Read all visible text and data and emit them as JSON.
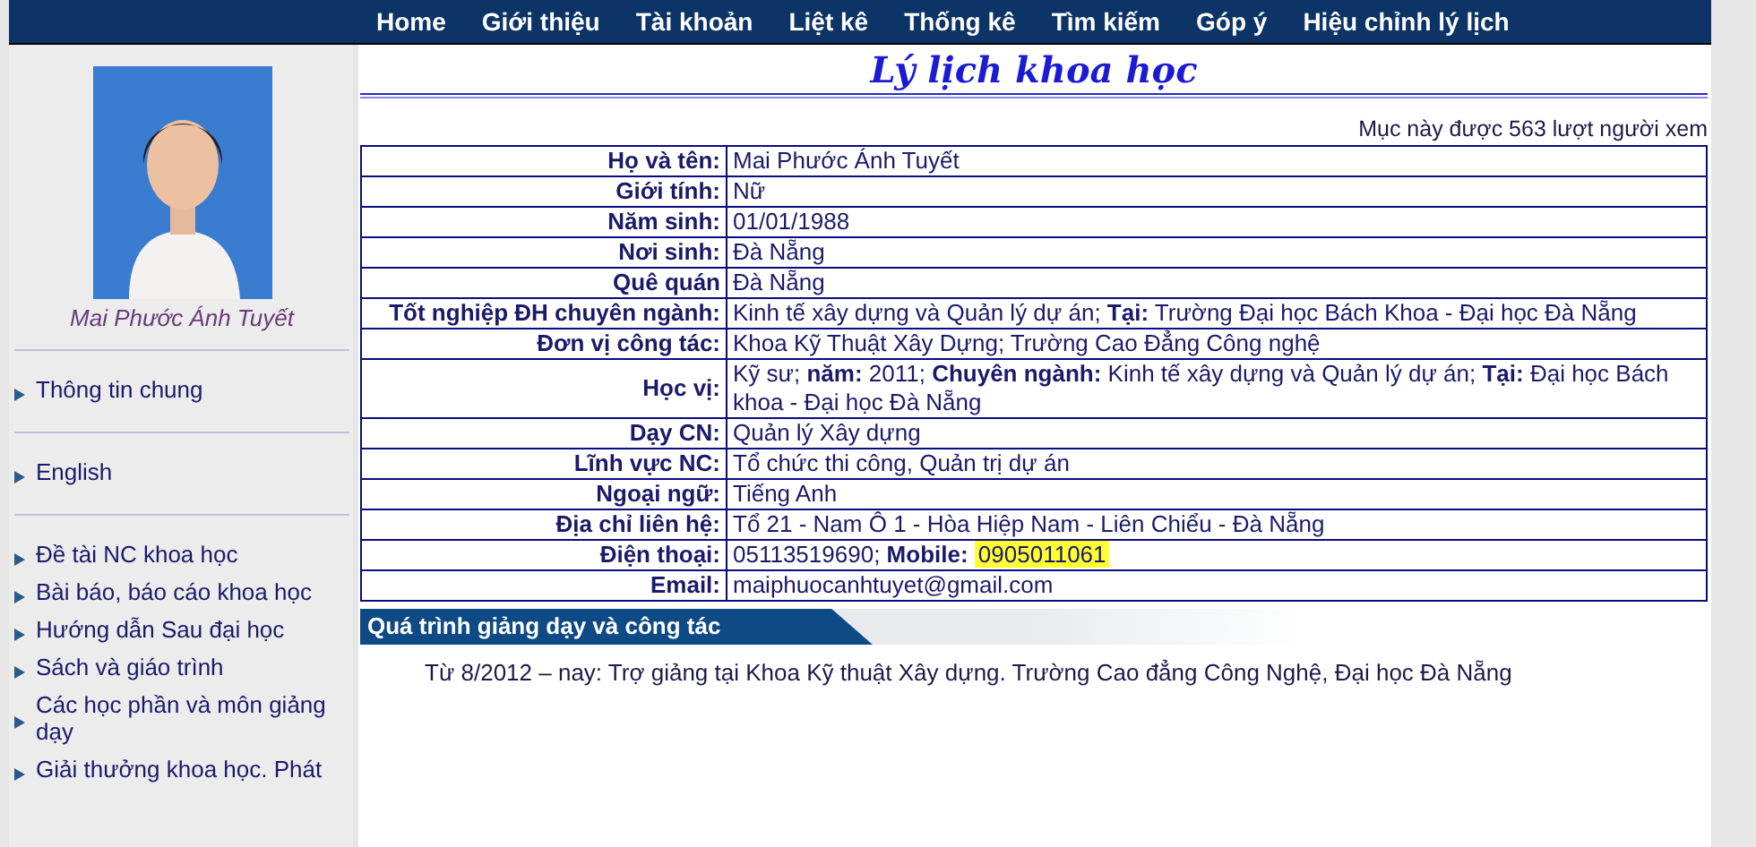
{
  "nav": [
    "Home",
    "Giới thiệu",
    "Tài khoản",
    "Liệt kê",
    "Thống kê",
    "Tìm kiếm",
    "Góp ý",
    "Hiệu chỉnh lý lịch"
  ],
  "sidebar": {
    "name": "Mai Phước Ánh Tuyết",
    "groups": [
      [
        "Thông tin chung"
      ],
      [
        "English"
      ],
      [
        "Đề tài NC khoa học",
        "Bài báo, báo cáo khoa học",
        "Hướng dẫn Sau đại học",
        "Sách và giáo trình",
        "Các học phần và môn giảng dạy",
        "Giải thưởng khoa học. Phát"
      ]
    ]
  },
  "page_title": "Lý lịch khoa học",
  "view_count": "Mục này được 563 lượt người xem",
  "profile": [
    {
      "label": "Họ và tên:",
      "value": "Mai Phước Ánh Tuyết"
    },
    {
      "label": "Giới tính:",
      "value": "Nữ"
    },
    {
      "label": "Năm sinh:",
      "value": "01/01/1988"
    },
    {
      "label": "Nơi sinh:",
      "value": "Đà Nẵng"
    },
    {
      "label": "Quê quán",
      "value": "Đà Nẵng"
    },
    {
      "label": "Tốt nghiệp ĐH chuyên ngành:",
      "value": "Kinh tế xây dựng và Quản lý dự án; **Tại:** Trường Đại học Bách Khoa - Đại học Đà Nẵng"
    },
    {
      "label": "Đơn vị công tác:",
      "value": "Khoa Kỹ Thuật Xây Dựng; Trường Cao Đẳng Công nghệ"
    },
    {
      "label": "Học vị:",
      "value": "Kỹ sư; **năm:** 2011; **Chuyên ngành:** Kinh tế xây dựng và Quản lý dự án; **Tại:** Đại học Bách khoa - Đại học Đà Nẵng"
    },
    {
      "label": "Dạy CN:",
      "value": "Quản lý Xây dựng"
    },
    {
      "label": "Lĩnh vực NC:",
      "value": "Tổ chức thi công, Quản trị dự án"
    },
    {
      "label": "Ngoại ngữ:",
      "value": "Tiếng Anh"
    },
    {
      "label": "Địa chỉ liên hệ:",
      "value": "Tổ 21 - Nam Ô 1 - Hòa Hiệp Nam - Liên Chiểu - Đà Nẵng"
    },
    {
      "label": "Điện thoại:",
      "value": "05113519690; **Mobile:**",
      "highlight": "0905011061"
    },
    {
      "label": "Email:",
      "value": "maiphuocanhtuyet@gmail.com"
    }
  ],
  "section": {
    "title": "Quá trình giảng dạy và công tác",
    "text": "Từ 8/2012 – nay: Trợ giảng tại Khoa Kỹ thuật Xây dựng. Trường Cao đẳng Công Nghệ, Đại học Đà Nẵng"
  }
}
